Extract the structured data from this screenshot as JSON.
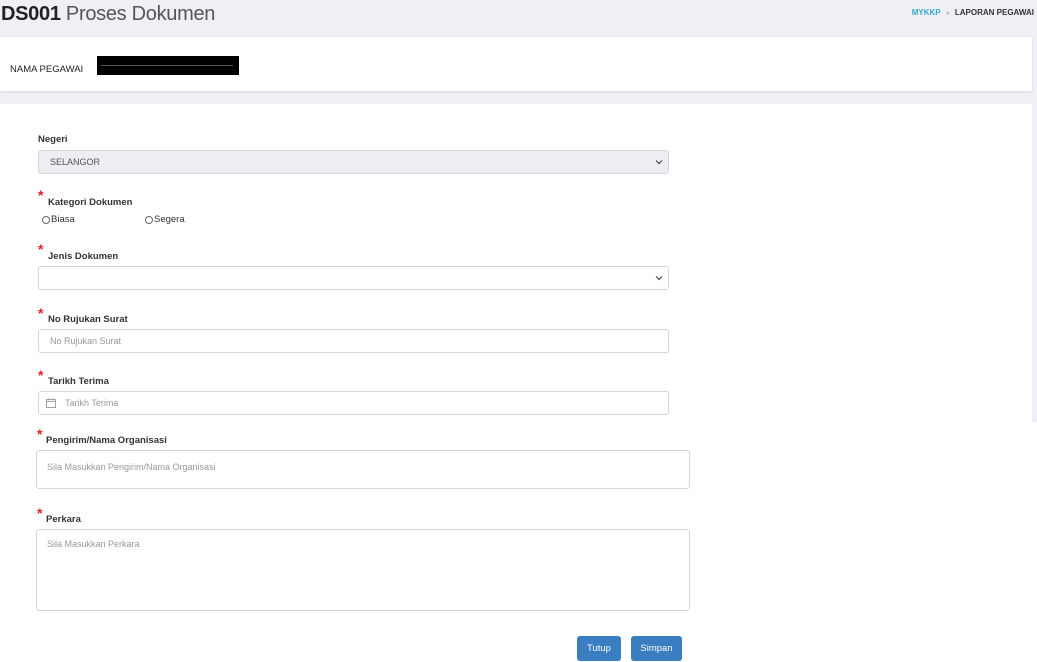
{
  "header": {
    "code": "DS001",
    "title": "Proses Dokumen"
  },
  "breadcrumb": {
    "link": "MYKKP",
    "current": "LAPORAN PEGAWAI"
  },
  "staff": {
    "label": "NAMA PEGAWAI"
  },
  "form": {
    "negeri": {
      "label": "Negeri",
      "value": "SELANGOR"
    },
    "kategori": {
      "label": "Kategori Dokumen",
      "options": [
        "Biasa",
        "Segera"
      ]
    },
    "jenis": {
      "label": "Jenis Dokumen",
      "value": ""
    },
    "rujukan": {
      "label": "No Rujukan Surat",
      "placeholder": "No Rujukan Surat"
    },
    "tarikh": {
      "label": "Tarikh Terima",
      "placeholder": "Tarikh Terima"
    },
    "pengirim": {
      "label": "Pengirim/Nama Organisasi",
      "placeholder": "Sila Masukkan Pengirim/Nama Organisasi"
    },
    "perkara": {
      "label": "Perkara",
      "placeholder": "Sila Masukkan Perkara"
    }
  },
  "actions": {
    "close_label": "Tutup",
    "save_label": "Simpan"
  },
  "colors": {
    "accent": "#3a7ec1",
    "breadcrumb_link": "#36a9c9",
    "required": "#e4202a",
    "band": "#eef0f6"
  },
  "icons": {
    "select_arrow": "chevron-down-icon",
    "date": "calendar-icon"
  }
}
